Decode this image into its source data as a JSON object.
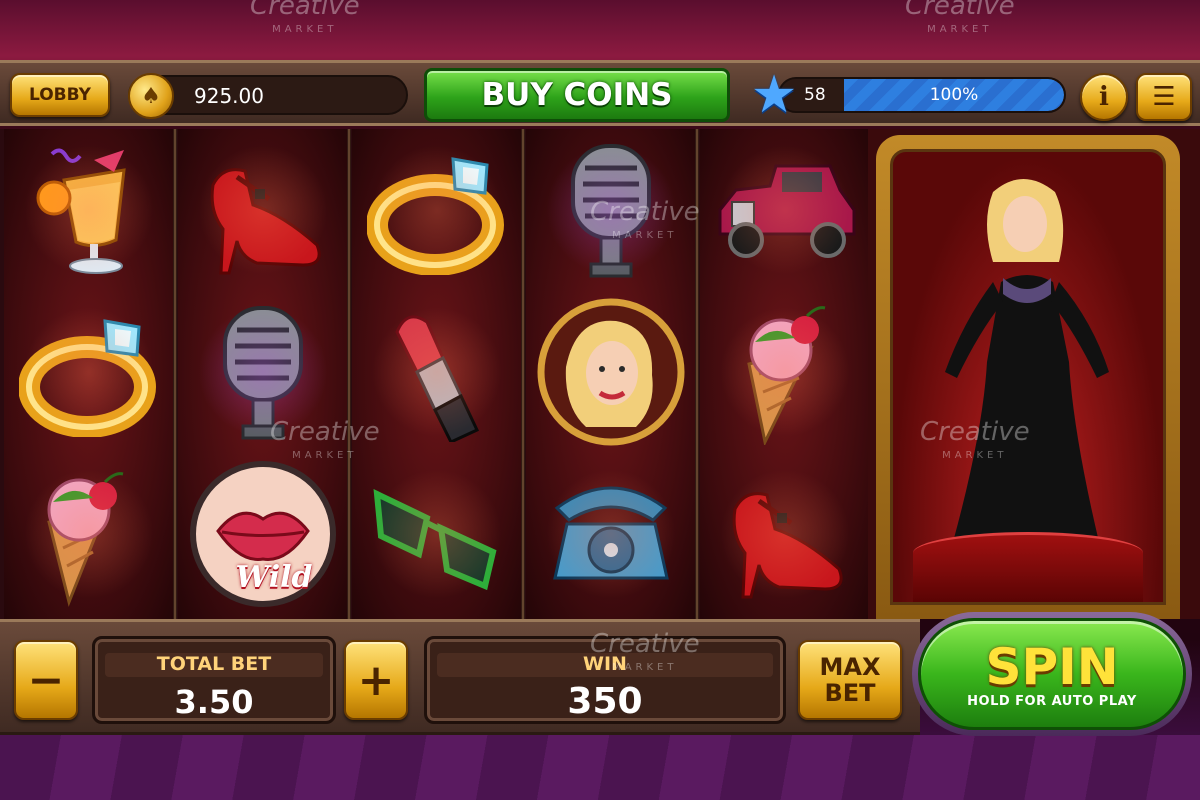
{
  "header": {
    "lobby_label": "LOBBY",
    "coin_balance": "925.00",
    "coin_icon": "spade-coin-icon",
    "buy_coins_label": "BUY COINS",
    "level": "58",
    "level_progress_label": "100%",
    "level_progress": 1.0,
    "star_icon": "star-icon",
    "info_icon": "info-icon",
    "menu_icon": "hamburger-menu-icon"
  },
  "reels": [
    {
      "symbols": [
        "cocktail",
        "gold-ring",
        "ice-cream-cone"
      ]
    },
    {
      "symbols": [
        "red-heel-shoe",
        "retro-microphone",
        "lips-wild"
      ]
    },
    {
      "symbols": [
        "gold-ring",
        "lipstick",
        "green-sunglasses"
      ]
    },
    {
      "symbols": [
        "retro-microphone",
        "blonde-portrait",
        "rotary-phone"
      ]
    },
    {
      "symbols": [
        "vintage-car",
        "ice-cream-cone",
        "red-heel-shoe"
      ]
    }
  ],
  "wild_label": "Wild",
  "bottom": {
    "minus_label": "−",
    "plus_label": "+",
    "total_bet_label": "TOTAL BET",
    "total_bet_value": "3.50",
    "win_label": "WIN",
    "win_value": "350",
    "max_bet_line1": "MAX",
    "max_bet_line2": "BET",
    "spin_label": "SPIN",
    "spin_sub_label": "HOLD FOR AUTO PLAY"
  },
  "watermark": {
    "brand": "Creative",
    "sub": "MARKET"
  }
}
